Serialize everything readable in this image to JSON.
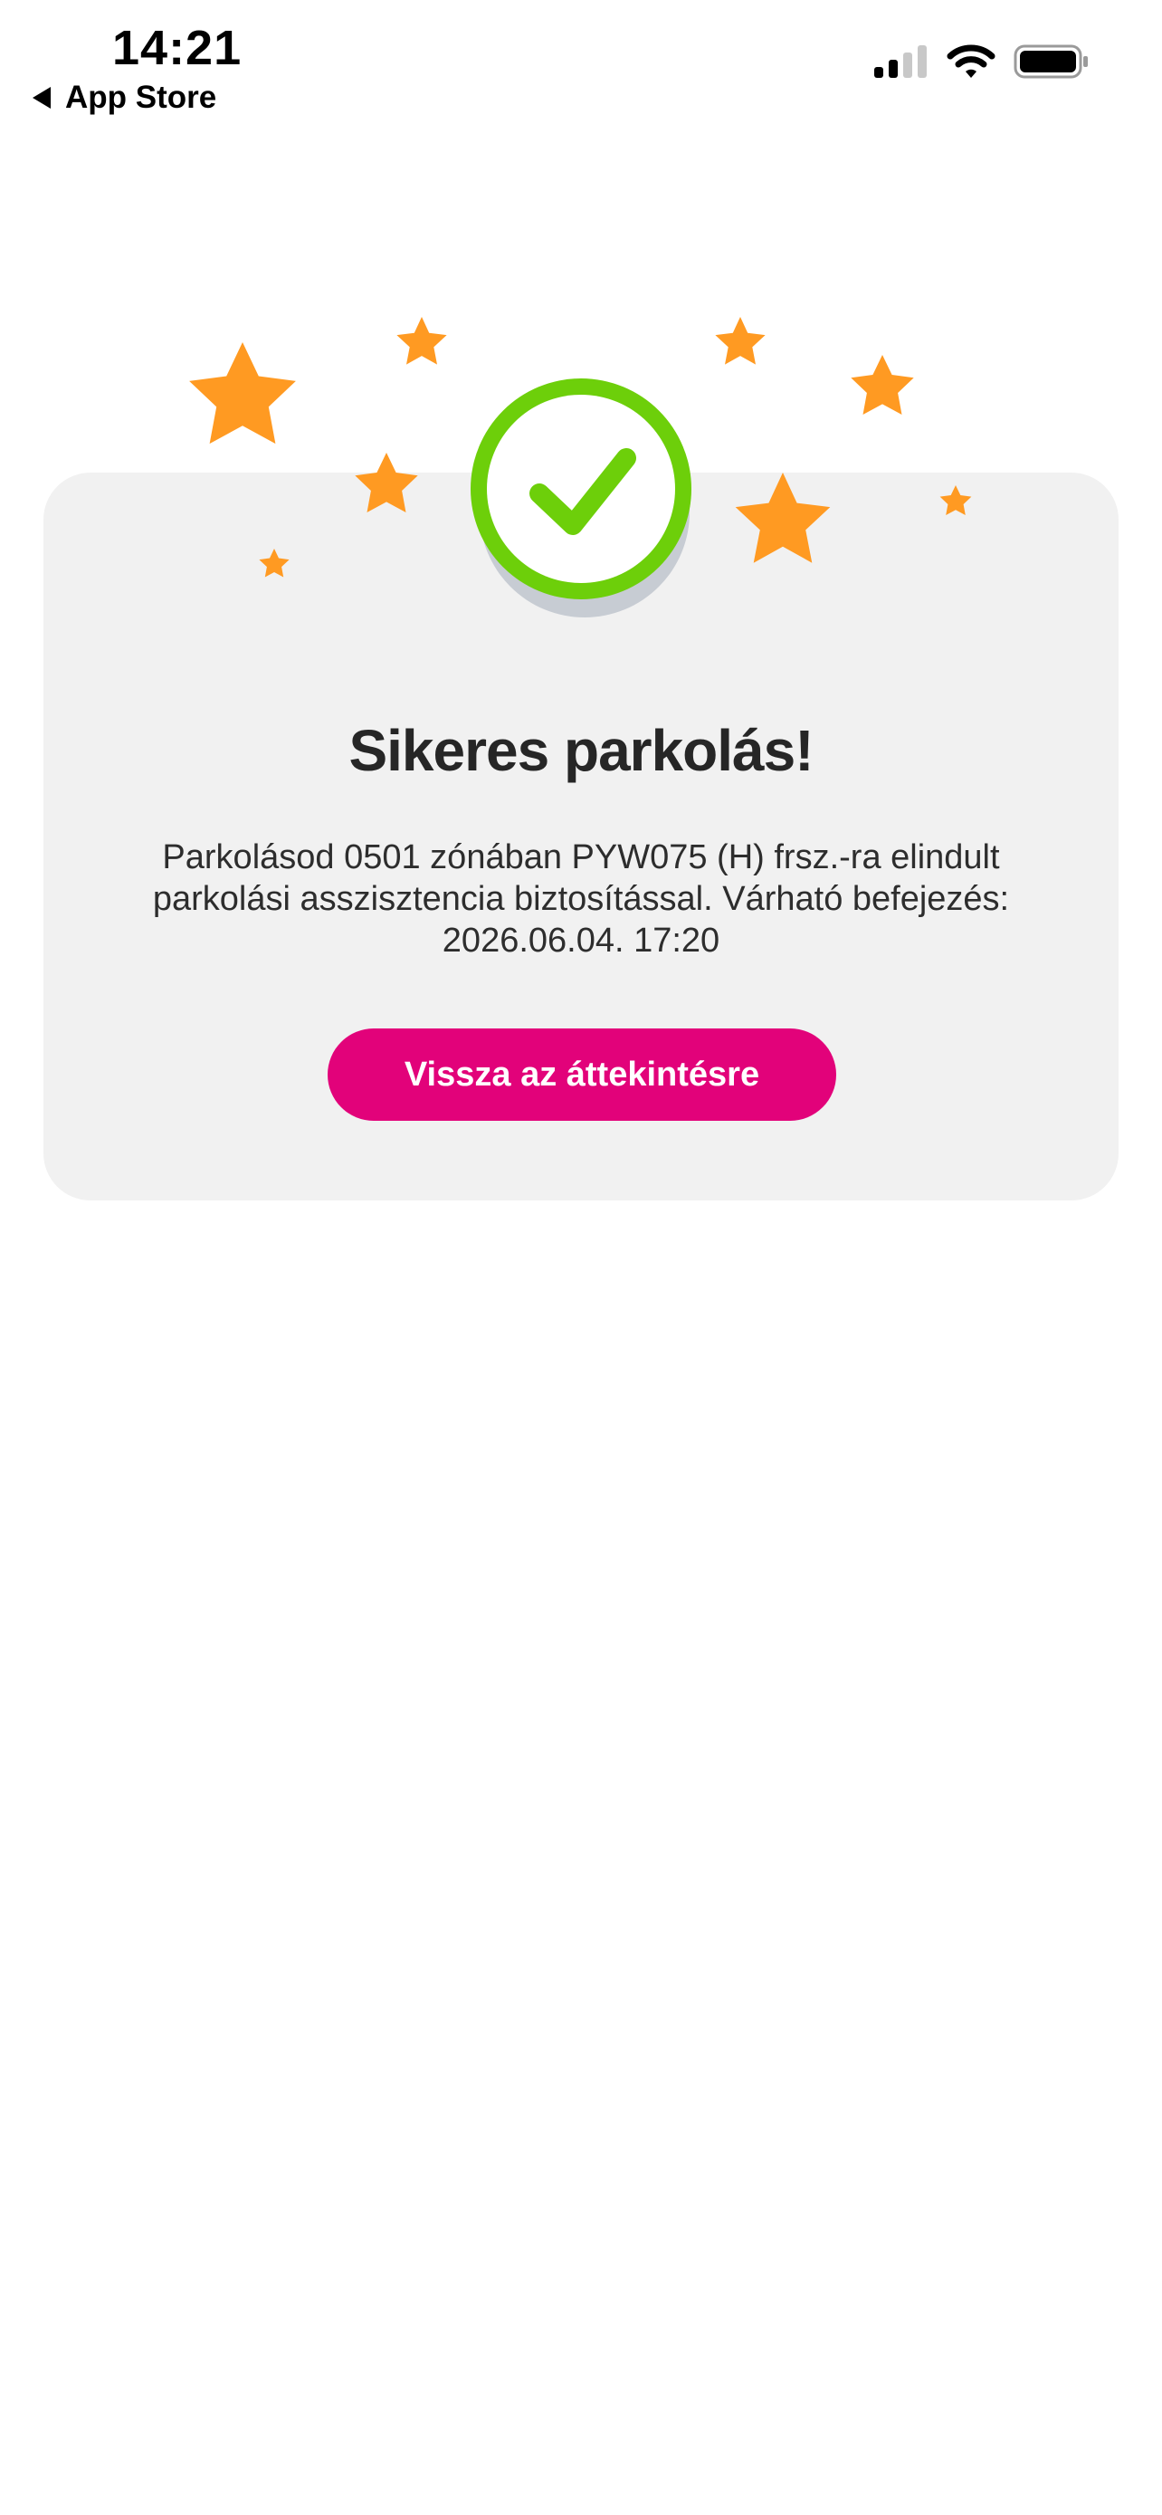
{
  "status_bar": {
    "time": "14:21",
    "back_label": "App Store",
    "icons": [
      "signal-icon",
      "wifi-icon",
      "battery-icon"
    ]
  },
  "result": {
    "status_icon": "checkmark-circle-icon",
    "title": "Sikeres parkolás!",
    "message": "Parkolásod 0501 zónában PYW075 (H) frsz.-ra elindult parkolási asszisztencia biztosítással. Várható befejezés: 2026.06.04. 17:20",
    "button_label": "Vissza az áttekintésre"
  },
  "colors": {
    "accent": "#e2027a",
    "success": "#6dcf0a",
    "star": "#ff9a22",
    "card_background": "#f1f1f1"
  }
}
